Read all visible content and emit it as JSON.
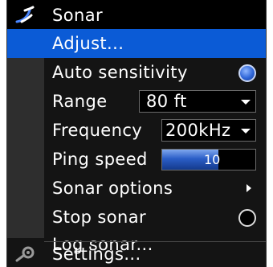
{
  "menu": {
    "title": "Sonar",
    "title_icon": "sonar-icon",
    "items": [
      {
        "label": "Adjust..."
      },
      {
        "label": "Auto sensitivity",
        "toggle": "on"
      },
      {
        "label": "Range",
        "value": "80 ft"
      },
      {
        "label": "Frequency",
        "value": "200kHz"
      },
      {
        "label": "Ping speed",
        "value": "10",
        "level_fraction": 0.6
      },
      {
        "label": "Sonar options",
        "has_submenu": true
      },
      {
        "label": "Stop sonar",
        "toggle": "off"
      },
      {
        "label": "Log sonar..."
      },
      {
        "label": "Settings...",
        "icon": "settings-icon"
      }
    ]
  },
  "colors": {
    "selection": "#0b5bd6",
    "background": "#141414",
    "gutter": "#2e2e2e"
  }
}
